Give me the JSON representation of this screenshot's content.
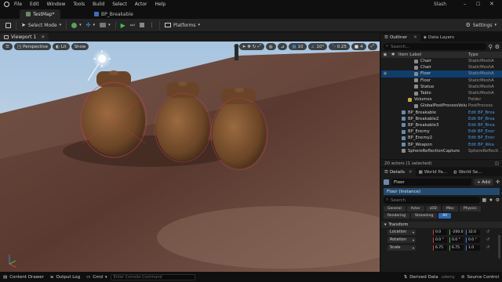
{
  "menu": {
    "items": [
      "File",
      "Edit",
      "Window",
      "Tools",
      "Build",
      "Select",
      "Actor",
      "Help"
    ],
    "project": "Slash"
  },
  "tabs": [
    {
      "label": "TestMap*"
    },
    {
      "label": "BP_Breakable"
    }
  ],
  "toolbar": {
    "mode_label": "Select Mode",
    "platforms_label": "Platforms",
    "settings_label": "Settings"
  },
  "viewport": {
    "tab_label": "Viewport 1",
    "perspective_label": "Perspective",
    "lit_label": "Lit",
    "show_label": "Show",
    "grid_snap": "10",
    "rotation_snap": "10°",
    "scale_snap": "0.25",
    "camera_speed": "4"
  },
  "outliner": {
    "tabs": [
      "Outliner",
      "Data Layers"
    ],
    "search_placeholder": "Search...",
    "col_label": "Item Label",
    "col_type": "Type",
    "rows": [
      {
        "label": "Chair",
        "type": "StaticMeshA",
        "indent": 4,
        "sel": false,
        "link": false
      },
      {
        "label": "Chair",
        "type": "StaticMeshA",
        "indent": 4,
        "sel": false,
        "link": false
      },
      {
        "label": "Floor",
        "type": "StaticMeshA",
        "indent": 4,
        "sel": true,
        "link": false
      },
      {
        "label": "Floor",
        "type": "StaticMeshA",
        "indent": 4,
        "sel": false,
        "link": false
      },
      {
        "label": "Statue",
        "type": "StaticMeshA",
        "indent": 4,
        "sel": false,
        "link": false
      },
      {
        "label": "Table",
        "type": "StaticMeshA",
        "indent": 4,
        "sel": false,
        "link": false
      },
      {
        "label": "Volumes",
        "type": "Folder",
        "indent": 3,
        "sel": false,
        "link": false
      },
      {
        "label": "GlobalPostProcessVolu",
        "type": "PostProcess",
        "indent": 4,
        "sel": false,
        "link": false
      },
      {
        "label": "BP_Breakable",
        "type": "Edit BP_Brea",
        "indent": 2,
        "sel": false,
        "link": true
      },
      {
        "label": "BP_Breakable2",
        "type": "Edit BP_Brea",
        "indent": 2,
        "sel": false,
        "link": true
      },
      {
        "label": "BP_Breakable3",
        "type": "Edit BP_Brea",
        "indent": 2,
        "sel": false,
        "link": true
      },
      {
        "label": "BP_Enemy",
        "type": "Edit BP_Ener",
        "indent": 2,
        "sel": false,
        "link": true
      },
      {
        "label": "BP_Enemy2",
        "type": "Edit BP_Ener",
        "indent": 2,
        "sel": false,
        "link": true
      },
      {
        "label": "BP_Weapon",
        "type": "Edit BP_Wea",
        "indent": 2,
        "sel": false,
        "link": true
      },
      {
        "label": "SphereReflectionCapture",
        "type": "SphereReflecti",
        "indent": 2,
        "sel": false,
        "link": false
      }
    ],
    "footer": "20 actors (1 selected)"
  },
  "details": {
    "tabs": [
      "Details",
      "World Pa...",
      "World Se..."
    ],
    "actor_name": "Floor",
    "add_label": "+ Add",
    "instance_label": "Floor (Instance)",
    "search_placeholder": "Search",
    "filters": [
      "General",
      "Actor",
      "LOD",
      "Misc",
      "Physics",
      "Rendering",
      "Streaming",
      "All"
    ],
    "active_filter": "All",
    "section": "Transform",
    "props": [
      {
        "name": "Location",
        "values": [
          "0.0",
          "-200.0",
          "32.0"
        ]
      },
      {
        "name": "Rotation",
        "values": [
          "0.0 °",
          "0.0 °",
          "0.0 °"
        ]
      },
      {
        "name": "Scale",
        "values": [
          "6.75",
          "6.75",
          "1.0"
        ]
      }
    ]
  },
  "status": {
    "content_drawer": "Content Drawer",
    "output_log": "Output Log",
    "cmd": "Cmd",
    "cmd_placeholder": "Enter Console Command",
    "derived_data": "Derived Data",
    "source_control": "Source Control"
  },
  "watermark": "udemy",
  "colors": {
    "accent": "#2b68b0",
    "selection": "#0f3e6e",
    "link": "#4b9ae8",
    "play": "#3fbf4f"
  }
}
